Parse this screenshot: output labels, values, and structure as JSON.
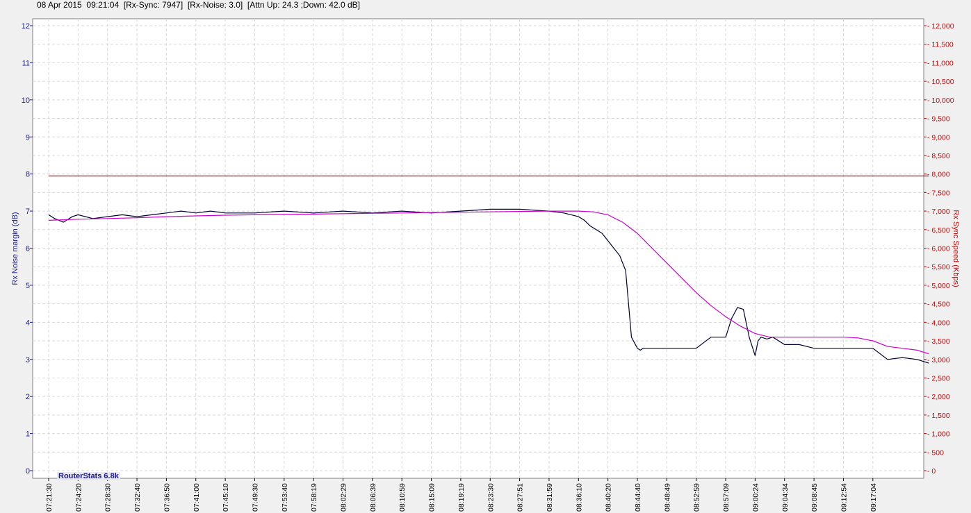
{
  "header": {
    "date": "08 Apr 2015",
    "time": "09:21:04",
    "rx_sync": "[Rx-Sync: 7947]",
    "rx_noise": "[Rx-Noise: 3.0]",
    "attn": "[Attn Up: 24.3 ;Down: 42.0 dB]"
  },
  "watermark": "RouterStats 6.8k",
  "colors": {
    "noise": "#000033",
    "sync": "#cc0000",
    "avg": "#cc00cc",
    "left_axis": "#1a1a8c",
    "right_axis": "#cc0000"
  },
  "chart_data": {
    "type": "line",
    "ylabel": "Rx Noise margin (dB)",
    "y2label": "Rx Sync Speed (Kbps)",
    "ylim": [
      0,
      12
    ],
    "y2lim": [
      0,
      12000
    ],
    "yticks": [
      "0",
      "1",
      "2",
      "3",
      "4",
      "5",
      "6",
      "7",
      "8",
      "9",
      "10",
      "11",
      "12"
    ],
    "y2ticks": [
      "0",
      "500",
      "1,000",
      "1,500",
      "2,000",
      "2,500",
      "3,000",
      "3,500",
      "4,000",
      "4,500",
      "5,000",
      "5,500",
      "6,000",
      "6,500",
      "7,000",
      "7,500",
      "8,000",
      "8,500",
      "9,000",
      "9,500",
      "10,000",
      "10,500",
      "11,000",
      "11,500",
      "12,000"
    ],
    "xticks": [
      "07:21:30",
      "07:24:20",
      "07:28:30",
      "07:32:40",
      "07:36:50",
      "07:41:00",
      "07:45:10",
      "07:49:30",
      "07:53:40",
      "07:58:19",
      "08:02:29",
      "08:06:39",
      "08:10:59",
      "08:15:09",
      "08:19:19",
      "08:23:30",
      "08:27:51",
      "08:31:59",
      "08:36:10",
      "08:40:20",
      "08:44:40",
      "08:48:49",
      "08:52:59",
      "08:57:09",
      "09:00:24",
      "09:04:34",
      "09:08:45",
      "09:12:54",
      "09:17:04"
    ],
    "grid": true,
    "series": [
      {
        "axis": "left",
        "x_index": [
          0,
          0.2,
          0.5,
          0.8,
          1,
          1.5,
          2,
          2.5,
          3,
          3.5,
          4,
          4.5,
          5,
          5.5,
          6,
          7,
          8,
          9,
          10,
          11,
          12,
          13,
          14,
          15,
          16,
          17,
          17.5,
          18,
          18.2,
          18.4,
          18.6,
          18.8,
          19,
          19.2,
          19.4,
          19.6,
          19.8,
          20,
          20.1,
          20.2,
          20.4,
          20.6,
          20.8,
          21,
          21.5,
          22,
          22.5,
          23,
          23.2,
          23.4,
          23.6,
          23.8,
          24,
          24.1,
          24.2,
          24.4,
          24.6,
          25,
          25.5,
          26,
          26.5,
          27,
          27.5,
          28,
          28.5,
          29,
          29.5,
          29.9
        ],
        "values": [
          6.9,
          6.8,
          6.7,
          6.85,
          6.9,
          6.8,
          6.85,
          6.9,
          6.85,
          6.9,
          6.95,
          7.0,
          6.95,
          7.0,
          6.95,
          6.95,
          7.0,
          6.95,
          7.0,
          6.95,
          7.0,
          6.95,
          7.0,
          7.05,
          7.05,
          7.0,
          6.95,
          6.85,
          6.75,
          6.6,
          6.5,
          6.4,
          6.2,
          6.0,
          5.8,
          5.4,
          3.6,
          3.3,
          3.25,
          3.3,
          3.3,
          3.3,
          3.3,
          3.3,
          3.3,
          3.3,
          3.6,
          3.6,
          4.1,
          4.4,
          4.35,
          3.6,
          3.1,
          3.5,
          3.6,
          3.55,
          3.6,
          3.4,
          3.4,
          3.3,
          3.3,
          3.3,
          3.3,
          3.3,
          3.0,
          3.05,
          3.0,
          2.9
        ],
        "name": "",
        "colorKey": "noise"
      },
      {
        "axis": "right",
        "x_index": [
          0,
          1,
          2,
          3,
          4,
          5,
          6,
          7,
          8,
          9,
          10,
          11,
          12,
          13,
          14,
          15,
          16,
          17,
          18,
          18.5,
          19,
          19.5,
          20,
          20.5,
          21,
          21.5,
          22,
          22.5,
          23,
          23.5,
          24,
          24.5,
          25,
          25.5,
          26,
          26.5,
          27,
          27.5,
          28,
          28.5,
          29,
          29.5,
          29.9
        ],
        "values": [
          6750,
          6780,
          6800,
          6820,
          6850,
          6870,
          6890,
          6900,
          6910,
          6920,
          6930,
          6940,
          6950,
          6960,
          6970,
          6980,
          6990,
          7000,
          7000,
          6980,
          6900,
          6700,
          6400,
          6000,
          5600,
          5200,
          4800,
          4450,
          4150,
          3900,
          3700,
          3600,
          3600,
          3600,
          3600,
          3600,
          3600,
          3580,
          3500,
          3350,
          3300,
          3250,
          3150
        ],
        "name": "",
        "colorKey": "avg"
      },
      {
        "axis": "right",
        "x_index": [
          0,
          29.9
        ],
        "values": [
          7947,
          7947
        ],
        "name": "",
        "colorKey": "sync"
      }
    ]
  }
}
